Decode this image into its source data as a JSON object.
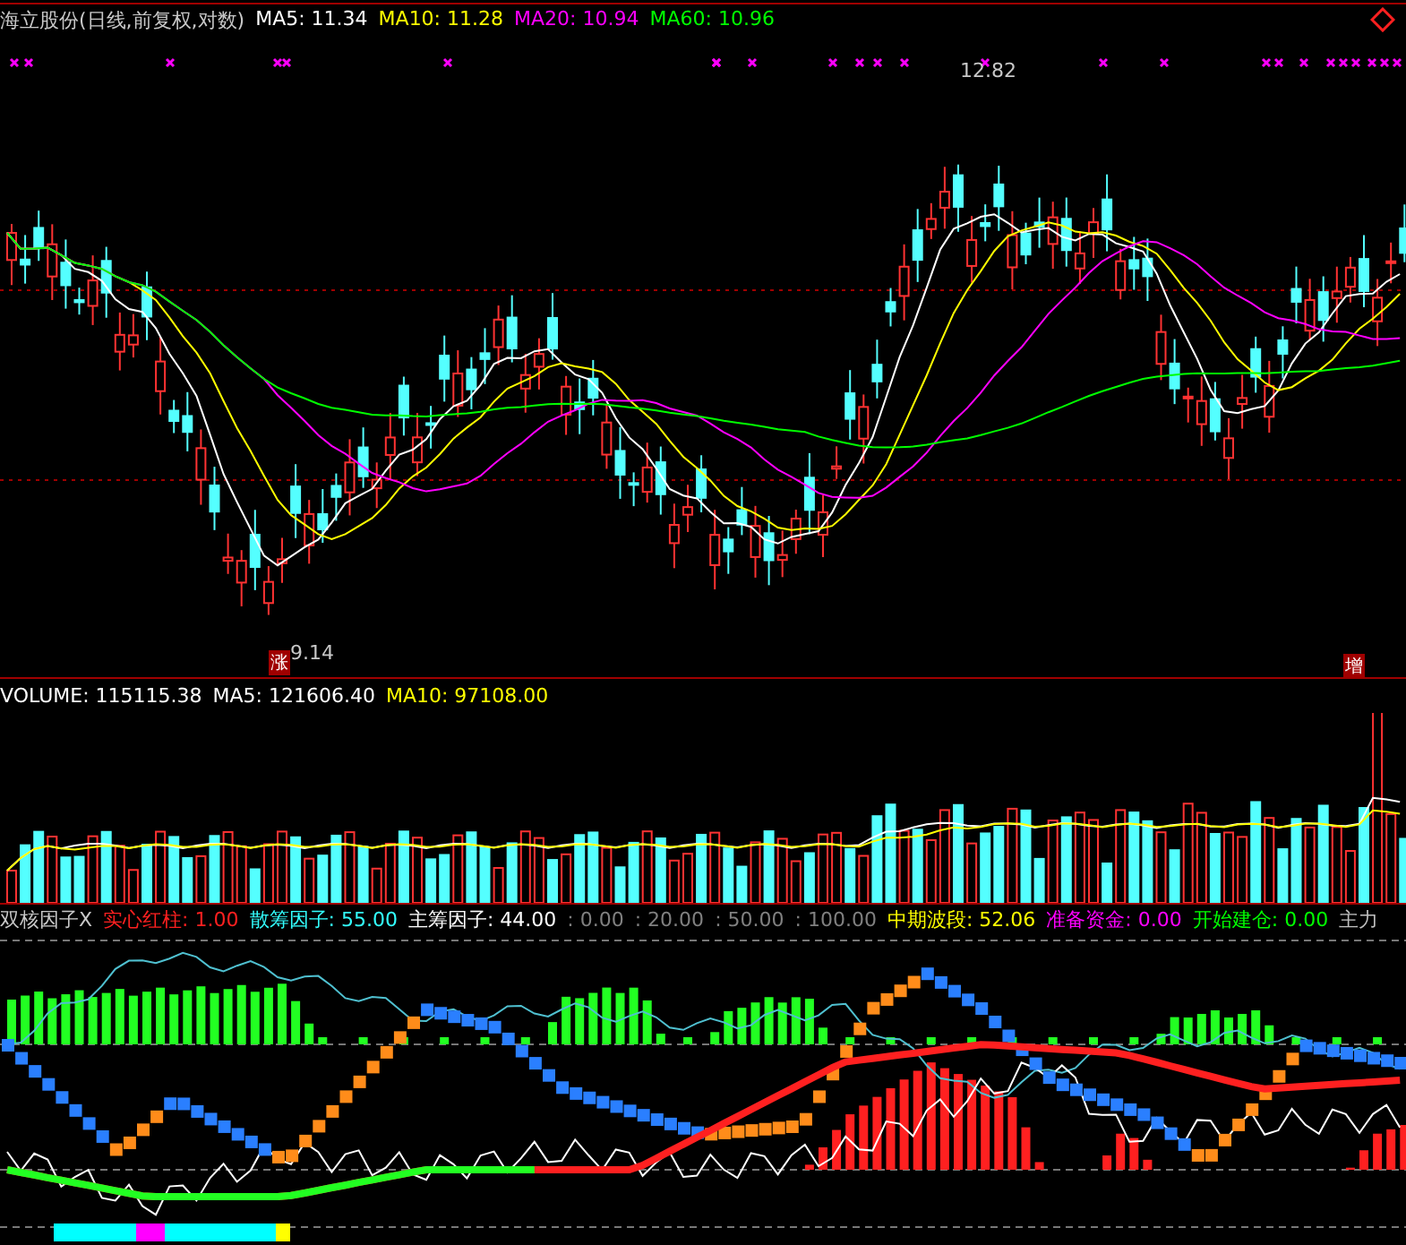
{
  "main_panel": {
    "title": "海立股份(日线,前复权,对数)",
    "indicators": [
      {
        "text": "MA5: 11.34",
        "color": "#ffffff"
      },
      {
        "text": "MA10: 11.28",
        "color": "#ffff00"
      },
      {
        "text": "MA20: 10.94",
        "color": "#ff00ff"
      },
      {
        "text": "MA60: 10.96",
        "color": "#00ff00"
      }
    ],
    "annotations": [
      {
        "text": "12.82",
        "kind": "price"
      },
      {
        "text": "9.14",
        "kind": "price"
      },
      {
        "text": "涨",
        "kind": "badge"
      },
      {
        "text": "增",
        "kind": "badge"
      }
    ]
  },
  "volume_panel": {
    "indicators": [
      {
        "text": "VOLUME: 115115.38",
        "color": "#ffffff"
      },
      {
        "text": "MA5: 121606.40",
        "color": "#ffffff"
      },
      {
        "text": "MA10: 97108.00",
        "color": "#ffff00"
      }
    ]
  },
  "indicator_panel": {
    "title": "双核因子X",
    "indicators": [
      {
        "text": "实心红柱: 1.00",
        "color": "#ff2020"
      },
      {
        "text": "散筹因子: 55.00",
        "color": "#33ffff"
      },
      {
        "text": "主筹因子: 44.00",
        "color": "#ffffff"
      },
      {
        "text": ": 0.00",
        "color": "#808080"
      },
      {
        "text": ": 20.00",
        "color": "#808080"
      },
      {
        "text": ": 50.00",
        "color": "#808080"
      },
      {
        "text": ": 100.00",
        "color": "#808080"
      },
      {
        "text": "中期波段: 52.06",
        "color": "#ffff00"
      },
      {
        "text": "准备资金: 0.00",
        "color": "#ff00ff"
      },
      {
        "text": "开始建仓: 0.00",
        "color": "#00ff00"
      },
      {
        "text": "主力",
        "color": "#c0c0c0"
      }
    ]
  }
}
